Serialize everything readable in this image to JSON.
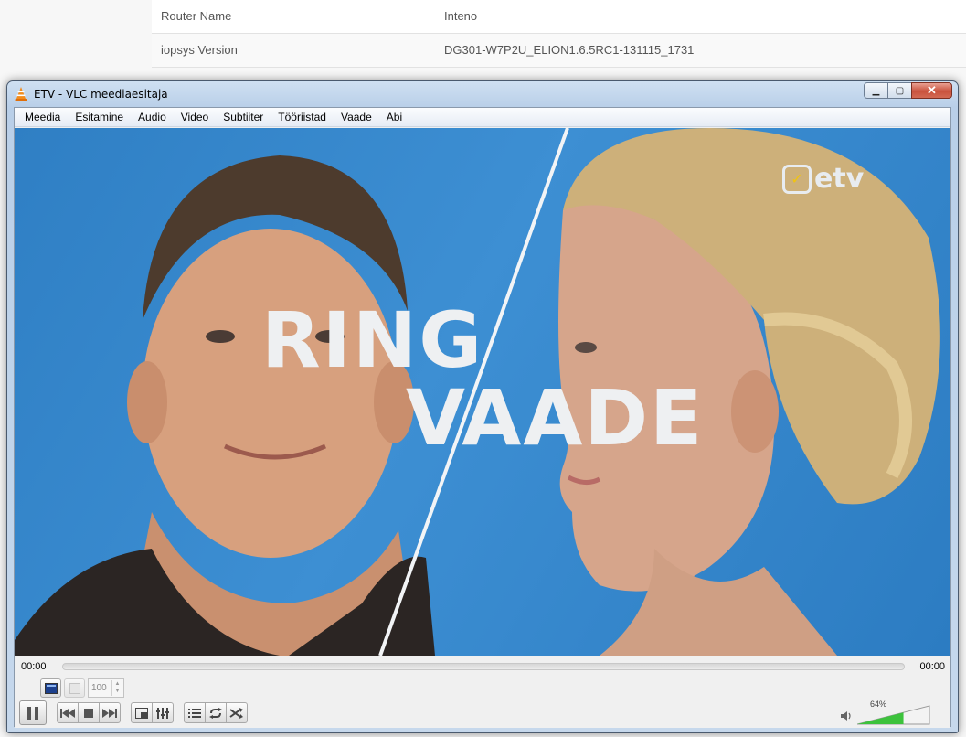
{
  "background_page": {
    "rows": [
      {
        "label": "Router Name",
        "value": "Inteno"
      },
      {
        "label": "iopsys Version",
        "value": "DG301-W7P2U_ELION1.6.5RC1-131115_1731"
      }
    ]
  },
  "window": {
    "title": "ETV - VLC meediaesitaja",
    "minimize_glyph": "▁",
    "maximize_glyph": "▢",
    "close_glyph": "✕"
  },
  "menu": [
    "Meedia",
    "Esitamine",
    "Audio",
    "Video",
    "Subtiiter",
    "Tööriistad",
    "Vaade",
    "Abi"
  ],
  "video": {
    "overlay_line1": "RING",
    "overlay_line2": "VAADE",
    "channel_logo": "etv",
    "logo_mark": "✓"
  },
  "playback": {
    "elapsed": "00:00",
    "total": "00:00",
    "progress": 0,
    "speed_value": "100",
    "volume_percent": "64%",
    "volume_level": 0.64
  },
  "icons": {
    "pause": "pause-icon",
    "previous": "previous-icon",
    "stop": "stop-icon",
    "next": "next-icon",
    "fullscreen": "fullscreen-icon",
    "extended_settings": "equalizer-icon",
    "playlist": "playlist-icon",
    "loop": "loop-icon",
    "shuffle": "shuffle-icon",
    "volume": "speaker-icon"
  },
  "colors": {
    "video_background": "#3389cf",
    "volume_fill": "#3cc23c",
    "close_button": "#c9523d"
  }
}
